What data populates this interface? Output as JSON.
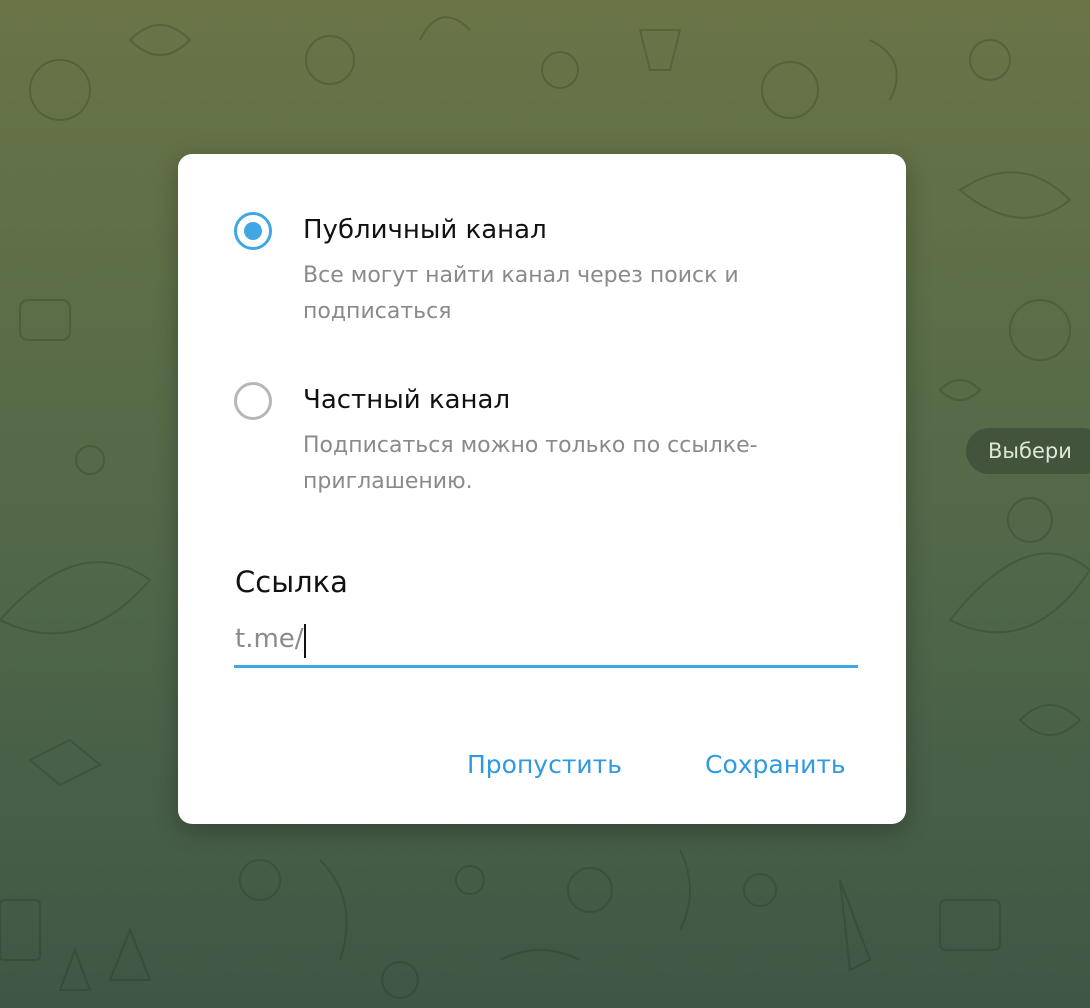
{
  "background": {
    "side_pill_text": "Выбери",
    "colors": {
      "top": "#6a7447",
      "bottom": "#3f5645"
    }
  },
  "dialog": {
    "options": [
      {
        "title": "Публичный канал",
        "description": "Все могут найти канал через поиск и подписаться",
        "selected": true
      },
      {
        "title": "Частный канал",
        "description": "Подписаться можно только по ссылке-приглашению.",
        "selected": false
      }
    ],
    "link": {
      "label": "Ссылка",
      "prefix": "t.me/",
      "value": ""
    },
    "buttons": {
      "skip": "Пропустить",
      "save": "Сохранить"
    },
    "colors": {
      "accent": "#40a7e3",
      "button_text": "#2f9ae0",
      "secondary_text": "#8a8a8a"
    }
  }
}
